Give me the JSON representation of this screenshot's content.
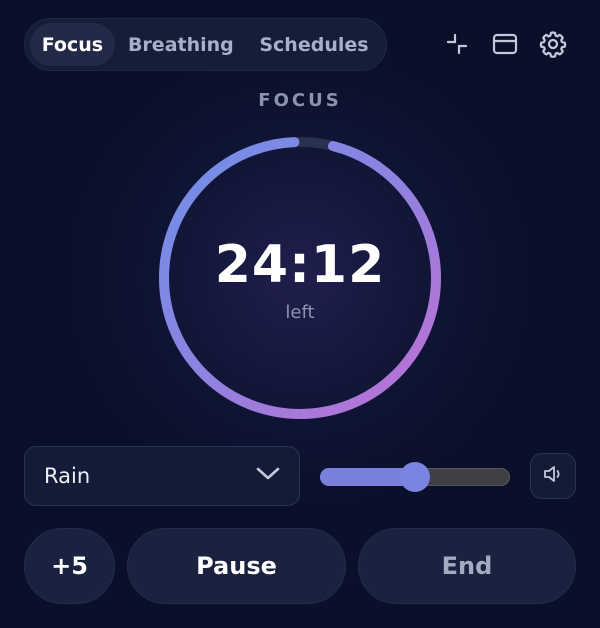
{
  "tabs": [
    {
      "label": "Focus",
      "active": true
    },
    {
      "label": "Breathing",
      "active": false
    },
    {
      "label": "Schedules",
      "active": false
    }
  ],
  "toolbar": {
    "icons": [
      "collapse-icon",
      "window-icon",
      "gear-icon"
    ]
  },
  "timer": {
    "mode_label": "FOCUS",
    "time": "24:12",
    "sub_label": "left",
    "progress": 0.968,
    "gradient_colors": [
      "#6e90e8",
      "#8f82e0",
      "#c06fd4"
    ],
    "track_color": "#2a3050"
  },
  "sound": {
    "selected": "Rain",
    "volume": 0.5
  },
  "actions": {
    "plus_label": "+5",
    "pause_label": "Pause",
    "end_label": "End"
  }
}
